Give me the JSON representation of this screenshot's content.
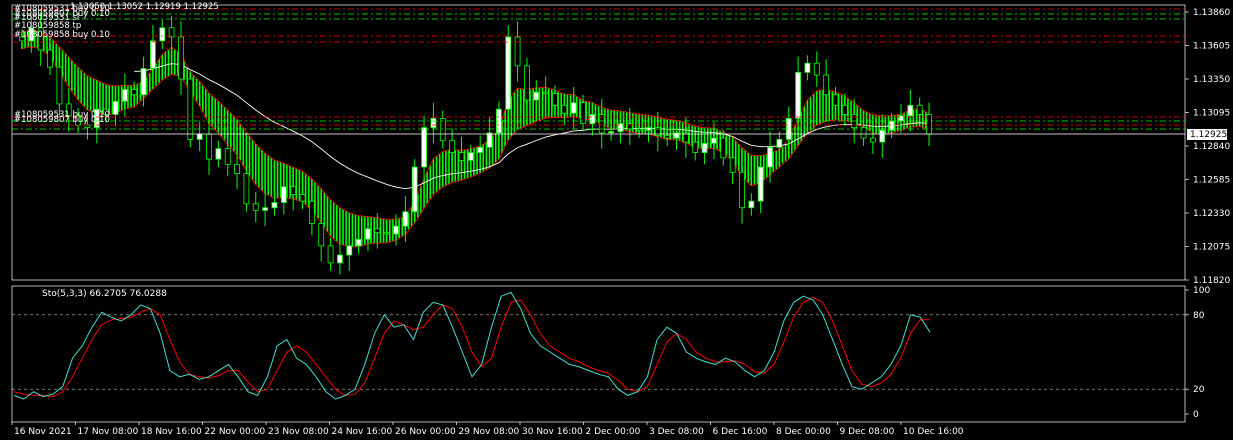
{
  "header": {
    "ohlc_text": "1.13050 1.13052 1.12919 1.12925"
  },
  "indicator": {
    "label": "Sto(5,3,3) 66.2705 76.0288"
  },
  "current_price_label": "1.12925",
  "trade_labels": [
    "#108059531 buy 0.10",
    "#108059807 buy 0.10",
    "#108059531 sl",
    "#108059858 tp",
    "#108059858 buy 0.10",
    "#108059531 buy 0.10",
    "#108059807 buy 0.10"
  ],
  "colors": {
    "background": "#000000",
    "bull": "#ffffff",
    "bear": "#000000",
    "wick": "#00ff00",
    "ribbon": "#00ff00",
    "ribbon_edge": "#ff0000",
    "ma": "#ffffff",
    "sl_line": "#ff0000",
    "tp_line": "#00ff00",
    "stoch_main": "#40e0d0",
    "stoch_signal": "#ff0000",
    "level_line": "#c0c0c0"
  },
  "chart_data": {
    "type": "candlestick",
    "title": "",
    "price_axis": {
      "ticks": [
        "1.13860",
        "1.13605",
        "1.13350",
        "1.13095",
        "1.12840",
        "1.12585",
        "1.12330",
        "1.12075",
        "1.11820"
      ],
      "ylim": [
        1.1182,
        1.1386
      ]
    },
    "time_axis": {
      "labels": [
        "16 Nov 2021",
        "17 Nov 08:00",
        "18 Nov 16:00",
        "22 Nov 00:00",
        "23 Nov 08:00",
        "24 Nov 16:00",
        "26 Nov 00:00",
        "29 Nov 08:00",
        "30 Nov 16:00",
        "2 Dec 00:00",
        "3 Dec 08:00",
        "6 Dec 16:00",
        "8 Dec 00:00",
        "9 Dec 08:00",
        "10 Dec 16:00"
      ]
    },
    "close": [
      1.1364,
      1.1374,
      1.1357,
      1.1344,
      1.1316,
      1.1307,
      1.13,
      1.1298,
      1.1312,
      1.1308,
      1.1318,
      1.1327,
      1.1323,
      1.1343,
      1.1364,
      1.1374,
      1.1367,
      1.1335,
      1.1289,
      1.1293,
      1.1274,
      1.1282,
      1.127,
      1.1263,
      1.124,
      1.1235,
      1.1237,
      1.1241,
      1.1253,
      1.1247,
      1.1242,
      1.1225,
      1.1208,
      1.1195,
      1.1201,
      1.1208,
      1.1213,
      1.1221,
      1.1218,
      1.1217,
      1.1223,
      1.1234,
      1.1268,
      1.1298,
      1.1305,
      1.1288,
      1.1279,
      1.1273,
      1.1279,
      1.1283,
      1.1294,
      1.1312,
      1.1367,
      1.1345,
      1.1319,
      1.1325,
      1.1324,
      1.1315,
      1.1309,
      1.1317,
      1.1301,
      1.1308,
      1.1294,
      1.1295,
      1.1301,
      1.1297,
      1.1296,
      1.1298,
      1.1292,
      1.129,
      1.1294,
      1.1287,
      1.1279,
      1.1286,
      1.129,
      1.1275,
      1.1264,
      1.1237,
      1.1242,
      1.1268,
      1.1283,
      1.1289,
      1.1305,
      1.134,
      1.1347,
      1.1338,
      1.1323,
      1.1315,
      1.1308,
      1.1298,
      1.129,
      1.1287,
      1.1296,
      1.1303,
      1.1307,
      1.1315,
      1.1308,
      1.1293
    ],
    "stochastic": {
      "levels": [
        20,
        80
      ],
      "axis_ticks": [
        "100",
        "80",
        "20",
        "0"
      ],
      "main": [
        15,
        12,
        18,
        14,
        16,
        22,
        45,
        55,
        70,
        82,
        78,
        75,
        80,
        88,
        85,
        65,
        35,
        30,
        32,
        28,
        30,
        35,
        40,
        30,
        18,
        15,
        30,
        55,
        60,
        45,
        40,
        30,
        18,
        12,
        15,
        20,
        40,
        65,
        80,
        70,
        72,
        60,
        82,
        90,
        88,
        70,
        50,
        30,
        40,
        70,
        95,
        98,
        85,
        65,
        55,
        50,
        45,
        40,
        38,
        35,
        32,
        30,
        20,
        15,
        18,
        30,
        60,
        70,
        65,
        50,
        45,
        42,
        40,
        45,
        42,
        35,
        30,
        35,
        50,
        75,
        90,
        95,
        92,
        80,
        60,
        40,
        22,
        20,
        25,
        30,
        40,
        55,
        80,
        78,
        66
      ],
      "signal": [
        18,
        16,
        15,
        15,
        14,
        18,
        30,
        45,
        60,
        72,
        76,
        77,
        78,
        82,
        85,
        80,
        60,
        42,
        32,
        30,
        29,
        31,
        35,
        35,
        26,
        18,
        20,
        35,
        50,
        55,
        50,
        40,
        30,
        20,
        15,
        16,
        25,
        45,
        65,
        75,
        72,
        68,
        70,
        80,
        88,
        85,
        70,
        50,
        38,
        45,
        70,
        90,
        92,
        80,
        65,
        55,
        50,
        45,
        42,
        38,
        35,
        33,
        27,
        20,
        18,
        22,
        40,
        58,
        65,
        60,
        50,
        45,
        42,
        42,
        43,
        40,
        34,
        33,
        40,
        58,
        78,
        90,
        94,
        90,
        75,
        55,
        35,
        24,
        22,
        25,
        32,
        45,
        65,
        76,
        76
      ]
    }
  }
}
